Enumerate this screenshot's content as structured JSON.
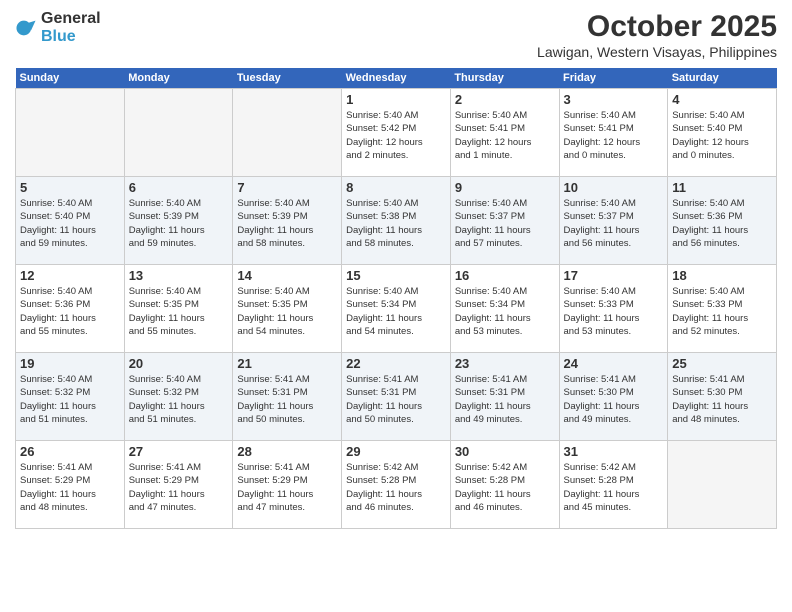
{
  "header": {
    "logo_general": "General",
    "logo_blue": "Blue",
    "month_title": "October 2025",
    "location": "Lawigan, Western Visayas, Philippines"
  },
  "days_of_week": [
    "Sunday",
    "Monday",
    "Tuesday",
    "Wednesday",
    "Thursday",
    "Friday",
    "Saturday"
  ],
  "weeks": [
    [
      {
        "day": "",
        "info": ""
      },
      {
        "day": "",
        "info": ""
      },
      {
        "day": "",
        "info": ""
      },
      {
        "day": "1",
        "info": "Sunrise: 5:40 AM\nSunset: 5:42 PM\nDaylight: 12 hours\nand 2 minutes."
      },
      {
        "day": "2",
        "info": "Sunrise: 5:40 AM\nSunset: 5:41 PM\nDaylight: 12 hours\nand 1 minute."
      },
      {
        "day": "3",
        "info": "Sunrise: 5:40 AM\nSunset: 5:41 PM\nDaylight: 12 hours\nand 0 minutes."
      },
      {
        "day": "4",
        "info": "Sunrise: 5:40 AM\nSunset: 5:40 PM\nDaylight: 12 hours\nand 0 minutes."
      }
    ],
    [
      {
        "day": "5",
        "info": "Sunrise: 5:40 AM\nSunset: 5:40 PM\nDaylight: 11 hours\nand 59 minutes."
      },
      {
        "day": "6",
        "info": "Sunrise: 5:40 AM\nSunset: 5:39 PM\nDaylight: 11 hours\nand 59 minutes."
      },
      {
        "day": "7",
        "info": "Sunrise: 5:40 AM\nSunset: 5:39 PM\nDaylight: 11 hours\nand 58 minutes."
      },
      {
        "day": "8",
        "info": "Sunrise: 5:40 AM\nSunset: 5:38 PM\nDaylight: 11 hours\nand 58 minutes."
      },
      {
        "day": "9",
        "info": "Sunrise: 5:40 AM\nSunset: 5:37 PM\nDaylight: 11 hours\nand 57 minutes."
      },
      {
        "day": "10",
        "info": "Sunrise: 5:40 AM\nSunset: 5:37 PM\nDaylight: 11 hours\nand 56 minutes."
      },
      {
        "day": "11",
        "info": "Sunrise: 5:40 AM\nSunset: 5:36 PM\nDaylight: 11 hours\nand 56 minutes."
      }
    ],
    [
      {
        "day": "12",
        "info": "Sunrise: 5:40 AM\nSunset: 5:36 PM\nDaylight: 11 hours\nand 55 minutes."
      },
      {
        "day": "13",
        "info": "Sunrise: 5:40 AM\nSunset: 5:35 PM\nDaylight: 11 hours\nand 55 minutes."
      },
      {
        "day": "14",
        "info": "Sunrise: 5:40 AM\nSunset: 5:35 PM\nDaylight: 11 hours\nand 54 minutes."
      },
      {
        "day": "15",
        "info": "Sunrise: 5:40 AM\nSunset: 5:34 PM\nDaylight: 11 hours\nand 54 minutes."
      },
      {
        "day": "16",
        "info": "Sunrise: 5:40 AM\nSunset: 5:34 PM\nDaylight: 11 hours\nand 53 minutes."
      },
      {
        "day": "17",
        "info": "Sunrise: 5:40 AM\nSunset: 5:33 PM\nDaylight: 11 hours\nand 53 minutes."
      },
      {
        "day": "18",
        "info": "Sunrise: 5:40 AM\nSunset: 5:33 PM\nDaylight: 11 hours\nand 52 minutes."
      }
    ],
    [
      {
        "day": "19",
        "info": "Sunrise: 5:40 AM\nSunset: 5:32 PM\nDaylight: 11 hours\nand 51 minutes."
      },
      {
        "day": "20",
        "info": "Sunrise: 5:40 AM\nSunset: 5:32 PM\nDaylight: 11 hours\nand 51 minutes."
      },
      {
        "day": "21",
        "info": "Sunrise: 5:41 AM\nSunset: 5:31 PM\nDaylight: 11 hours\nand 50 minutes."
      },
      {
        "day": "22",
        "info": "Sunrise: 5:41 AM\nSunset: 5:31 PM\nDaylight: 11 hours\nand 50 minutes."
      },
      {
        "day": "23",
        "info": "Sunrise: 5:41 AM\nSunset: 5:31 PM\nDaylight: 11 hours\nand 49 minutes."
      },
      {
        "day": "24",
        "info": "Sunrise: 5:41 AM\nSunset: 5:30 PM\nDaylight: 11 hours\nand 49 minutes."
      },
      {
        "day": "25",
        "info": "Sunrise: 5:41 AM\nSunset: 5:30 PM\nDaylight: 11 hours\nand 48 minutes."
      }
    ],
    [
      {
        "day": "26",
        "info": "Sunrise: 5:41 AM\nSunset: 5:29 PM\nDaylight: 11 hours\nand 48 minutes."
      },
      {
        "day": "27",
        "info": "Sunrise: 5:41 AM\nSunset: 5:29 PM\nDaylight: 11 hours\nand 47 minutes."
      },
      {
        "day": "28",
        "info": "Sunrise: 5:41 AM\nSunset: 5:29 PM\nDaylight: 11 hours\nand 47 minutes."
      },
      {
        "day": "29",
        "info": "Sunrise: 5:42 AM\nSunset: 5:28 PM\nDaylight: 11 hours\nand 46 minutes."
      },
      {
        "day": "30",
        "info": "Sunrise: 5:42 AM\nSunset: 5:28 PM\nDaylight: 11 hours\nand 46 minutes."
      },
      {
        "day": "31",
        "info": "Sunrise: 5:42 AM\nSunset: 5:28 PM\nDaylight: 11 hours\nand 45 minutes."
      },
      {
        "day": "",
        "info": ""
      }
    ]
  ]
}
